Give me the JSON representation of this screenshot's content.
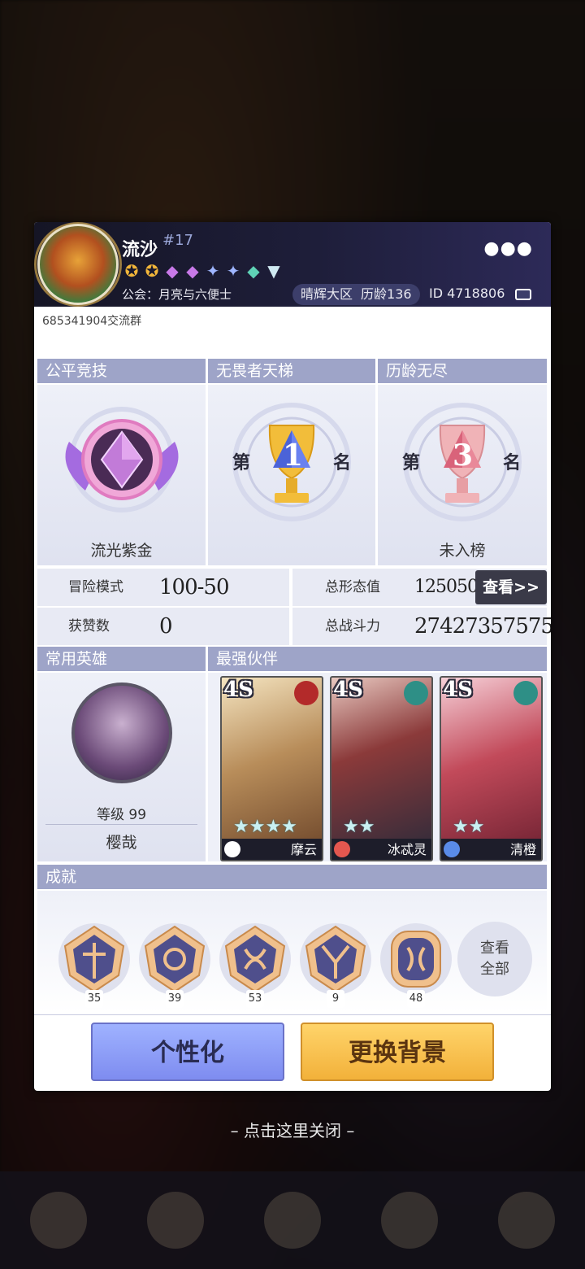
{
  "profile": {
    "name": "流沙",
    "rank_no": "#17",
    "guild": "公会：月亮与六便士",
    "server": "晴辉大区",
    "age": "历龄136",
    "user_id": "ID 4718806",
    "signature": "685341904交流群",
    "stars": [
      "gold",
      "gold",
      "purple",
      "purple",
      "blue",
      "blue",
      "teal",
      "silver"
    ]
  },
  "sections": {
    "fair": "公平竞技",
    "ladder": "无畏者天梯",
    "endless": "历龄无尽",
    "common_hero": "常用英雄",
    "partners": "最强伙伴",
    "achievements": "成就"
  },
  "ranks": {
    "fair_tier": "流光紫金",
    "ladder_prefix": "第",
    "ladder_num": "1",
    "ladder_suffix": "名",
    "endless_prefix": "第",
    "endless_num": "3",
    "endless_suffix": "名",
    "endless_label": "未入榜"
  },
  "stats": {
    "adventure_label": "冒险模式",
    "adventure_value": "100-50",
    "likes_label": "获赞数",
    "likes_value": "0",
    "form_label": "总形态值",
    "form_value": "125050",
    "power_label": "总战斗力",
    "power_value": "27427357575",
    "view_button": "查看>>"
  },
  "hero": {
    "level": "等级 99",
    "name": "樱哉"
  },
  "partners": [
    {
      "grade": "4S",
      "name": "摩云",
      "stars": "★★★★",
      "elem_color": "#b32a2a"
    },
    {
      "grade": "4S",
      "name": "冰忒灵",
      "stars": "★★",
      "elem_color": "#2e8f86"
    },
    {
      "grade": "4S",
      "name": "清橙",
      "stars": "★★",
      "elem_color": "#2e8f86"
    }
  ],
  "achievements": [
    {
      "count": "35"
    },
    {
      "count": "39"
    },
    {
      "count": "53"
    },
    {
      "count": "9"
    },
    {
      "count": "48"
    }
  ],
  "achievements_view_all": "查看\n全部",
  "buttons": {
    "personalize": "个性化",
    "change_bg": "更换背景"
  },
  "close_hint": "– 点击这里关闭 –"
}
